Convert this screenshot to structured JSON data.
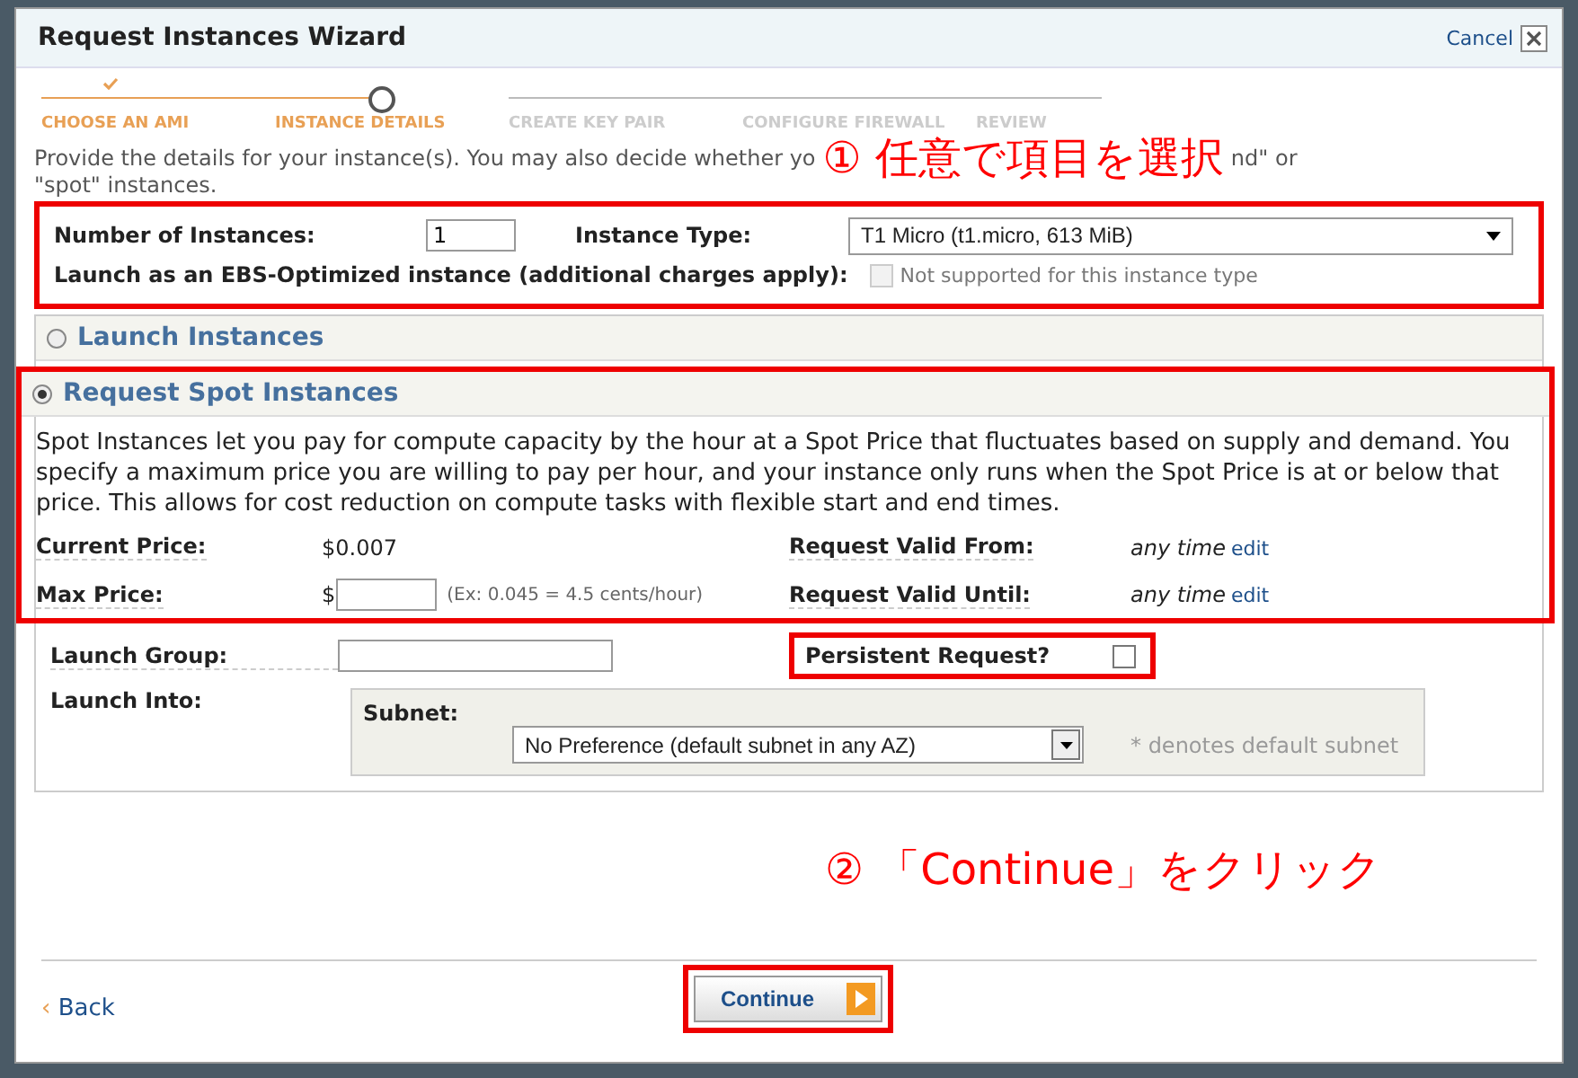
{
  "window": {
    "title": "Request Instances Wizard",
    "cancel": "Cancel"
  },
  "steps": [
    {
      "label": "CHOOSE AN AMI",
      "completed": true,
      "selected": false
    },
    {
      "label": "INSTANCE DETAILS",
      "completed": false,
      "selected": true
    },
    {
      "label": "CREATE KEY PAIR",
      "completed": false,
      "selected": false
    },
    {
      "label": "CONFIGURE FIREWALL",
      "completed": false,
      "selected": false
    },
    {
      "label": "REVIEW",
      "completed": false,
      "selected": false
    }
  ],
  "description": {
    "part_1": "Provide the details for your instance(s). You may also decide whether yo",
    "part_2": "nd\" or",
    "line_2": "\"spot\" instances."
  },
  "annotation_1": "① 任意で項目を選択",
  "instances": {
    "count_label": "Number of Instances:",
    "count_value": "1",
    "type_label": "Instance Type:",
    "type_value": "T1 Micro (t1.micro, 613 MiB)",
    "ebs_label": "Launch as an EBS-Optimized instance (additional charges apply):",
    "ebs_checked": false,
    "ebs_disabled": true,
    "ebs_note": "Not supported for this instance type"
  },
  "launch_options": [
    {
      "label": "Launch Instances",
      "selected": false
    },
    {
      "label": "Request Spot Instances",
      "selected": true
    }
  ],
  "spot": {
    "intro": "Spot Instances let you pay for compute capacity by the hour at a Spot Price that fluctuates based on supply and demand. You specify a maximum price you are willing to pay per hour, and your instance only runs when the Spot Price is at or below that price. This allows for cost reduction on compute tasks with flexible start and end times.",
    "current_price_label": "Current Price:",
    "current_price": "$0.007",
    "max_price_label": "Max Price:",
    "max_price_prefix": "$",
    "max_price_hint": "(Ex: 0.045 = 4.5 cents/hour)",
    "valid_from_label": "Request Valid From:",
    "valid_from": "any time",
    "valid_from_edit": "edit",
    "valid_until_label": "Request Valid Until:",
    "valid_until": "any time",
    "valid_until_edit": "edit",
    "launch_group_label": "Launch Group:",
    "persistent_label": "Persistent Request?",
    "persistent_checked": false,
    "launch_into_label": "Launch Into:",
    "subnet_label": "Subnet:",
    "subnet_value": "No Preference (default subnet in any AZ)",
    "subnet_note": "* denotes default subnet"
  },
  "annotation_2": "② 「Continue」をクリック",
  "footer": {
    "back": "Back",
    "back_icon": "‹",
    "continue": "Continue"
  }
}
